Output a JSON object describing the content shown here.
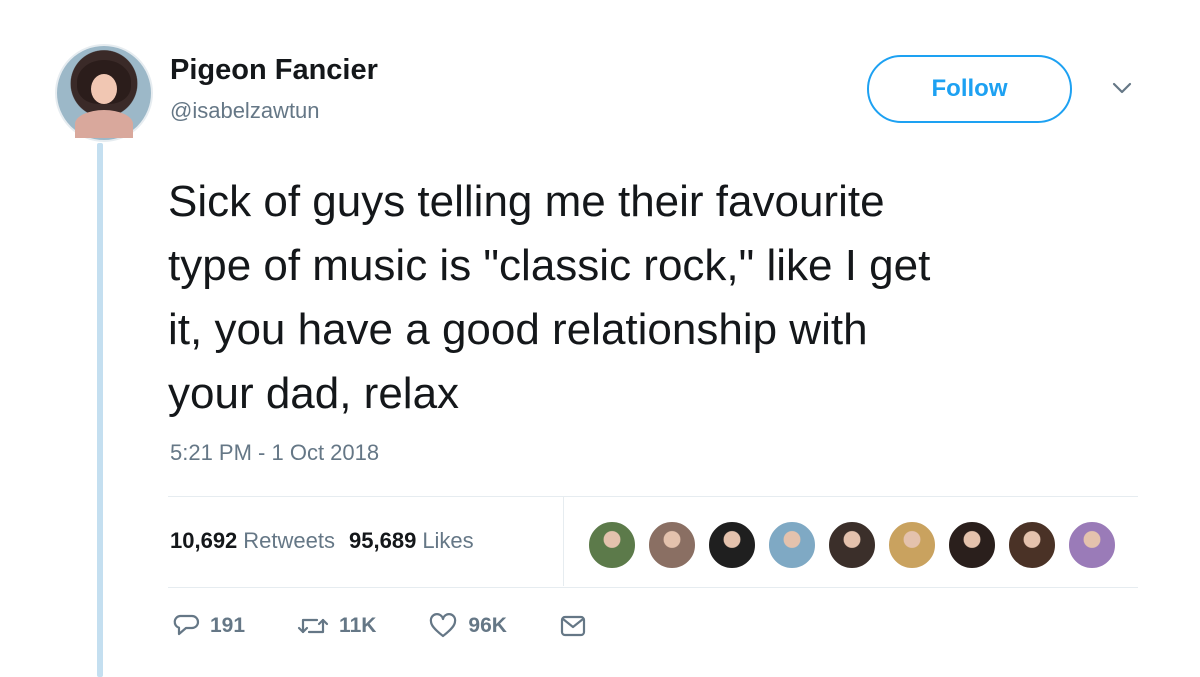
{
  "author": {
    "display_name": "Pigeon Fancier",
    "handle": "@isabelzawtun"
  },
  "follow_button": {
    "label": "Follow"
  },
  "tweet": {
    "text": "Sick of guys telling me their favourite\ntype of music is \"classic rock,\" like I get\nit, you have a good relationship with\nyour dad, relax",
    "timestamp": "5:21 PM - 1 Oct 2018"
  },
  "stats": {
    "retweets_count": "10,692",
    "retweets_label": "Retweets",
    "likes_count": "95,689",
    "likes_label": "Likes"
  },
  "liker_avatars": [
    {
      "color": "#5c7a4a"
    },
    {
      "color": "#8a6f63"
    },
    {
      "color": "#1f1f1f"
    },
    {
      "color": "#7fa9c4"
    },
    {
      "color": "#3b2f2a"
    },
    {
      "color": "#c9a25f"
    },
    {
      "color": "#2a1f1c"
    },
    {
      "color": "#4a3226"
    },
    {
      "color": "#9a7bb8"
    }
  ],
  "actions": {
    "reply_count": "191",
    "retweet_count": "11K",
    "like_count": "96K"
  },
  "colors": {
    "accent": "#1da1f2",
    "secondary_text": "#657786",
    "thread_line": "#c4dff0"
  },
  "icons": {
    "reply": "reply-icon",
    "retweet": "retweet-icon",
    "like": "heart-icon",
    "message": "envelope-icon",
    "more": "chevron-down-icon"
  }
}
